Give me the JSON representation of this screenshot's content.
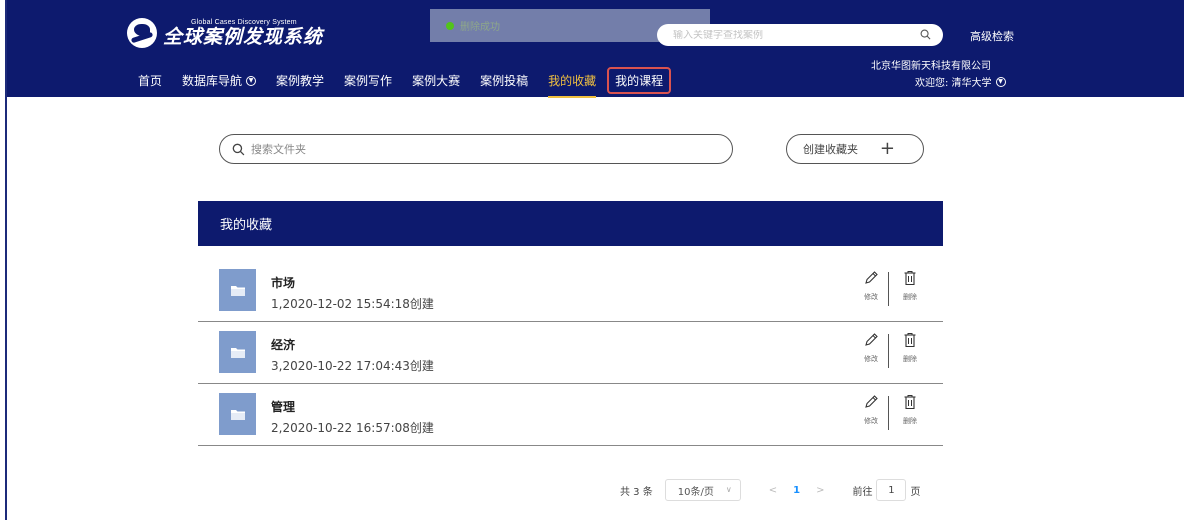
{
  "header": {
    "logo_en": "Global Cases Discovery System",
    "logo_cn": "全球案例发现系统",
    "search_placeholder": "输入关键字查找案例",
    "advanced_search": "高级检索",
    "company": "北京华图新天科技有限公司",
    "welcome": "欢迎您: 清华大学",
    "bg_color": "#0d1a6e",
    "active_color": "#f0c040"
  },
  "toast": {
    "message": "删除成功",
    "icon": "check-circle-icon"
  },
  "nav": {
    "items": [
      {
        "label": "首页"
      },
      {
        "label": "数据库导航"
      },
      {
        "label": "案例教学"
      },
      {
        "label": "案例写作"
      },
      {
        "label": "案例大赛"
      },
      {
        "label": "案例投稿"
      },
      {
        "label": "我的收藏"
      },
      {
        "label": "我的课程"
      }
    ],
    "active": "我的收藏",
    "highlighted": "我的课程"
  },
  "folder_search": {
    "placeholder": "搜索文件夹"
  },
  "create_folder": {
    "label": "创建收藏夹"
  },
  "panel": {
    "title": "我的收藏"
  },
  "folders": [
    {
      "name": "市场",
      "meta": "1,2020-12-02 15:54:18创建"
    },
    {
      "name": "经济",
      "meta": "3,2020-10-22 17:04:43创建"
    },
    {
      "name": "管理",
      "meta": "2,2020-10-22 16:57:08创建"
    }
  ],
  "actions": {
    "edit_label": "修改",
    "delete_label": "删除"
  },
  "pagination": {
    "total": "共 3 条",
    "page_size": "10条/页",
    "current_page": "1",
    "goto_prefix": "前往",
    "goto_value": "1",
    "goto_suffix": "页"
  }
}
